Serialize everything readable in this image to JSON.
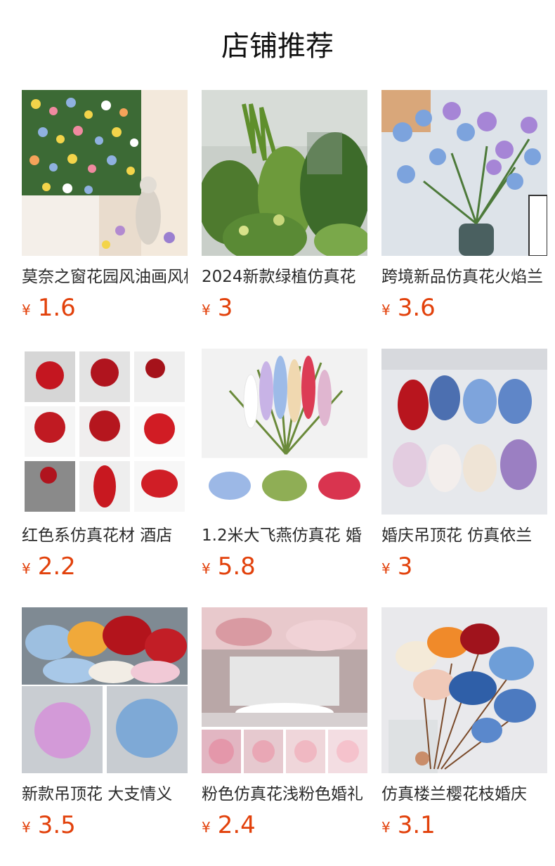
{
  "page_title": "店铺推荐",
  "products": [
    {
      "name": "莫奈之窗花园风油画风格仿真花墙",
      "currency": "¥",
      "price": "1.6",
      "image": "flower-wall-photo"
    },
    {
      "name": "2024新款绿植仿真花",
      "currency": "¥",
      "price": "3",
      "image": "green-plants-photo"
    },
    {
      "name": "跨境新品仿真花火焰兰",
      "currency": "¥",
      "price": "3.6",
      "image": "blue-purple-orchid-photo"
    },
    {
      "name": "红色系仿真花材 酒店",
      "currency": "¥",
      "price": "2.2",
      "image": "red-flowers-collage-photo"
    },
    {
      "name": "1.2米大飞燕仿真花 婚",
      "currency": "¥",
      "price": "5.8",
      "image": "delphinium-photo"
    },
    {
      "name": "婚庆吊顶花 仿真依兰",
      "currency": "¥",
      "price": "3",
      "image": "hanging-flowers-photo"
    },
    {
      "name": "新款吊顶花 大支情义",
      "currency": "¥",
      "price": "3.5",
      "image": "star-lily-photo"
    },
    {
      "name": "粉色仿真花浅粉色婚礼",
      "currency": "¥",
      "price": "2.4",
      "image": "wedding-stage-photo"
    },
    {
      "name": "仿真楼兰樱花枝婚庆",
      "currency": "¥",
      "price": "3.1",
      "image": "cherry-blossom-bouquet-photo"
    }
  ],
  "colors": {
    "price": "#e2410b",
    "title": "#111111",
    "name": "#2a2a2a"
  }
}
